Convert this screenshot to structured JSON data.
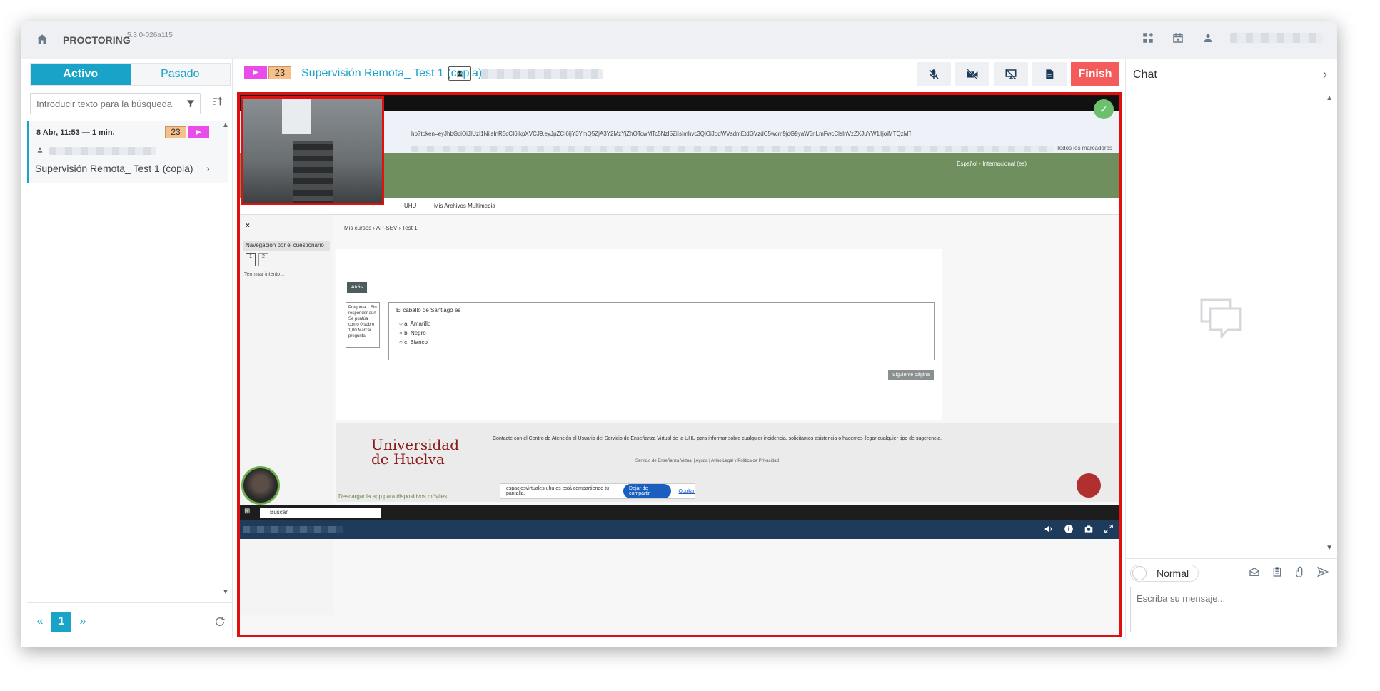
{
  "app": {
    "title": "PROCTORING",
    "version": "5.3.0-026a115"
  },
  "left": {
    "tabs": [
      {
        "label": "Activo"
      },
      {
        "label": "Pasado"
      }
    ],
    "search": {
      "placeholder": "Introducir texto para la búsqueda"
    },
    "items": [
      {
        "date": "8 Abr, 11:53 — 1 min.",
        "count": "23",
        "title": "Supervisión Remota_ Test 1 (copia)"
      }
    ],
    "pager": {
      "prev": "«",
      "current": "1",
      "next": "»"
    }
  },
  "session": {
    "count": "23",
    "title": "Supervisión Remota_ Test 1 (copia)",
    "finish_label": "Finish"
  },
  "screen": {
    "url": "hp?token=eyJhbGciOiJIUzI1NiIsInR5cCI6IkpXVCJ9.eyJpZCI6IjY3YmQ5ZjA3Y2MzYjZhOTcwMTc5NzI5ZiIsImhvc3QiOiJodWVsdmEtdGVzdC5wcm9jdG9yaW5nLmFwcClsInVzZXJuYW1lIjoiMTQzMTQiLCJuaWNrbmFtZSI...",
    "bookmarks_label": "Todos los marcadores",
    "lang_label": "Español - Internacional (es)",
    "menu": [
      "UHU",
      "Mis Archivos Multimedia"
    ],
    "close": "×",
    "nav_header": "Navegación por el cuestionario",
    "q_numbers": [
      "1",
      "2"
    ],
    "finish_attempt": "Terminar intento...",
    "breadcrumb": "Mis cursos  ›  AP-SEV  ›  Test 1",
    "back": "Atrás",
    "qinfo": "Pregunta 1 Sin responder aún Se puntúa como 0 sobre 1,00 Marcar pregunta",
    "question": "El caballo de Santiago es",
    "options": [
      "a.  Amarillo",
      "b.  Negro",
      "c.  Blanco"
    ],
    "next": "Siguiente página",
    "uni": "Universidad de Huelva",
    "contact": "Contacte con el Centro de Atención al Usuario del Servicio de Enseñanza Virtual de la UHU para informar sobre cualquier incidencia, solicitamos asistencia o hacemos llegar cualquier tipo de sugerencia.",
    "links": "Servicio de Enseñanza Virtual  |  Ayuda  |  Aviso Legal y Política de Privacidad",
    "app_download": "Descargar la app para dispositivos móviles",
    "share_text": "espaciosvirtuales.uhu.es está compartiendo tu pantalla.",
    "share_stop": "Dejar de compartir",
    "share_hide": "Ocultar",
    "taskbar_search": "Buscar"
  },
  "chat": {
    "title": "Chat",
    "mode": "Normal",
    "input_placeholder": "Escriba su mensaje..."
  },
  "colors": {
    "accent": "#1aa3c9",
    "finish": "#f45b5b",
    "frame": "#e01010",
    "play_badge": "#e94de9",
    "count_badge": "#f6c08a"
  }
}
